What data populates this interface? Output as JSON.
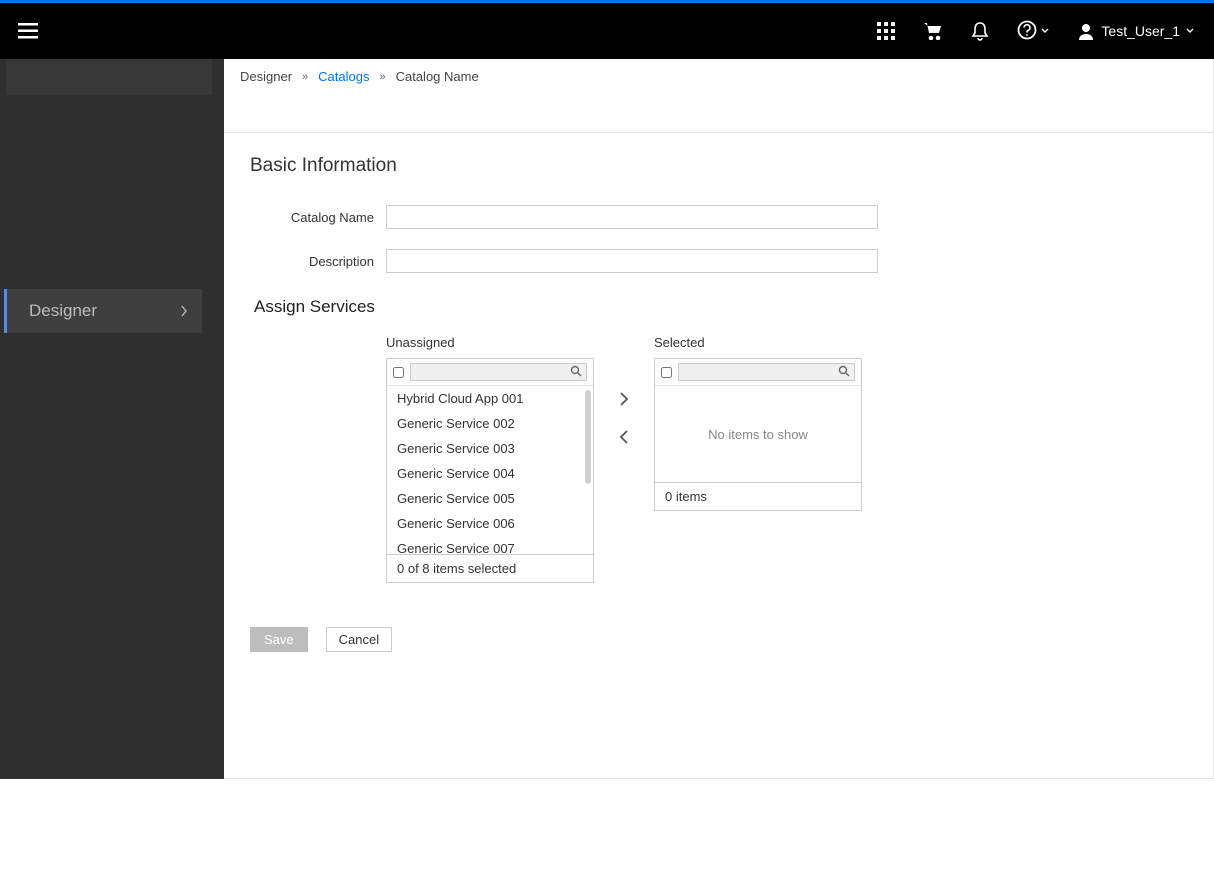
{
  "header": {
    "user_label": "Test_User_1"
  },
  "sidebar": {
    "designer_label": "Designer"
  },
  "breadcrumb": {
    "item1": "Designer",
    "item2": "Catalogs",
    "item3": "Catalog Name"
  },
  "form": {
    "section_title": "Basic Information",
    "catalog_name_label": "Catalog Name",
    "catalog_name_value": "",
    "description_label": "Description",
    "description_value": "",
    "assign_title": "Assign Services",
    "unassigned_label": "Unassigned",
    "selected_label": "Selected",
    "unassigned_items": [
      "Hybrid Cloud App 001",
      "Generic Service 002",
      "Generic Service 003",
      "Generic Service 004",
      "Generic Service 005",
      "Generic Service 006",
      "Generic Service 007"
    ],
    "unassigned_footer": "0 of 8 items selected",
    "selected_empty_text": "No items to show",
    "selected_footer": "0 items"
  },
  "actions": {
    "save_label": "Save",
    "cancel_label": "Cancel"
  }
}
